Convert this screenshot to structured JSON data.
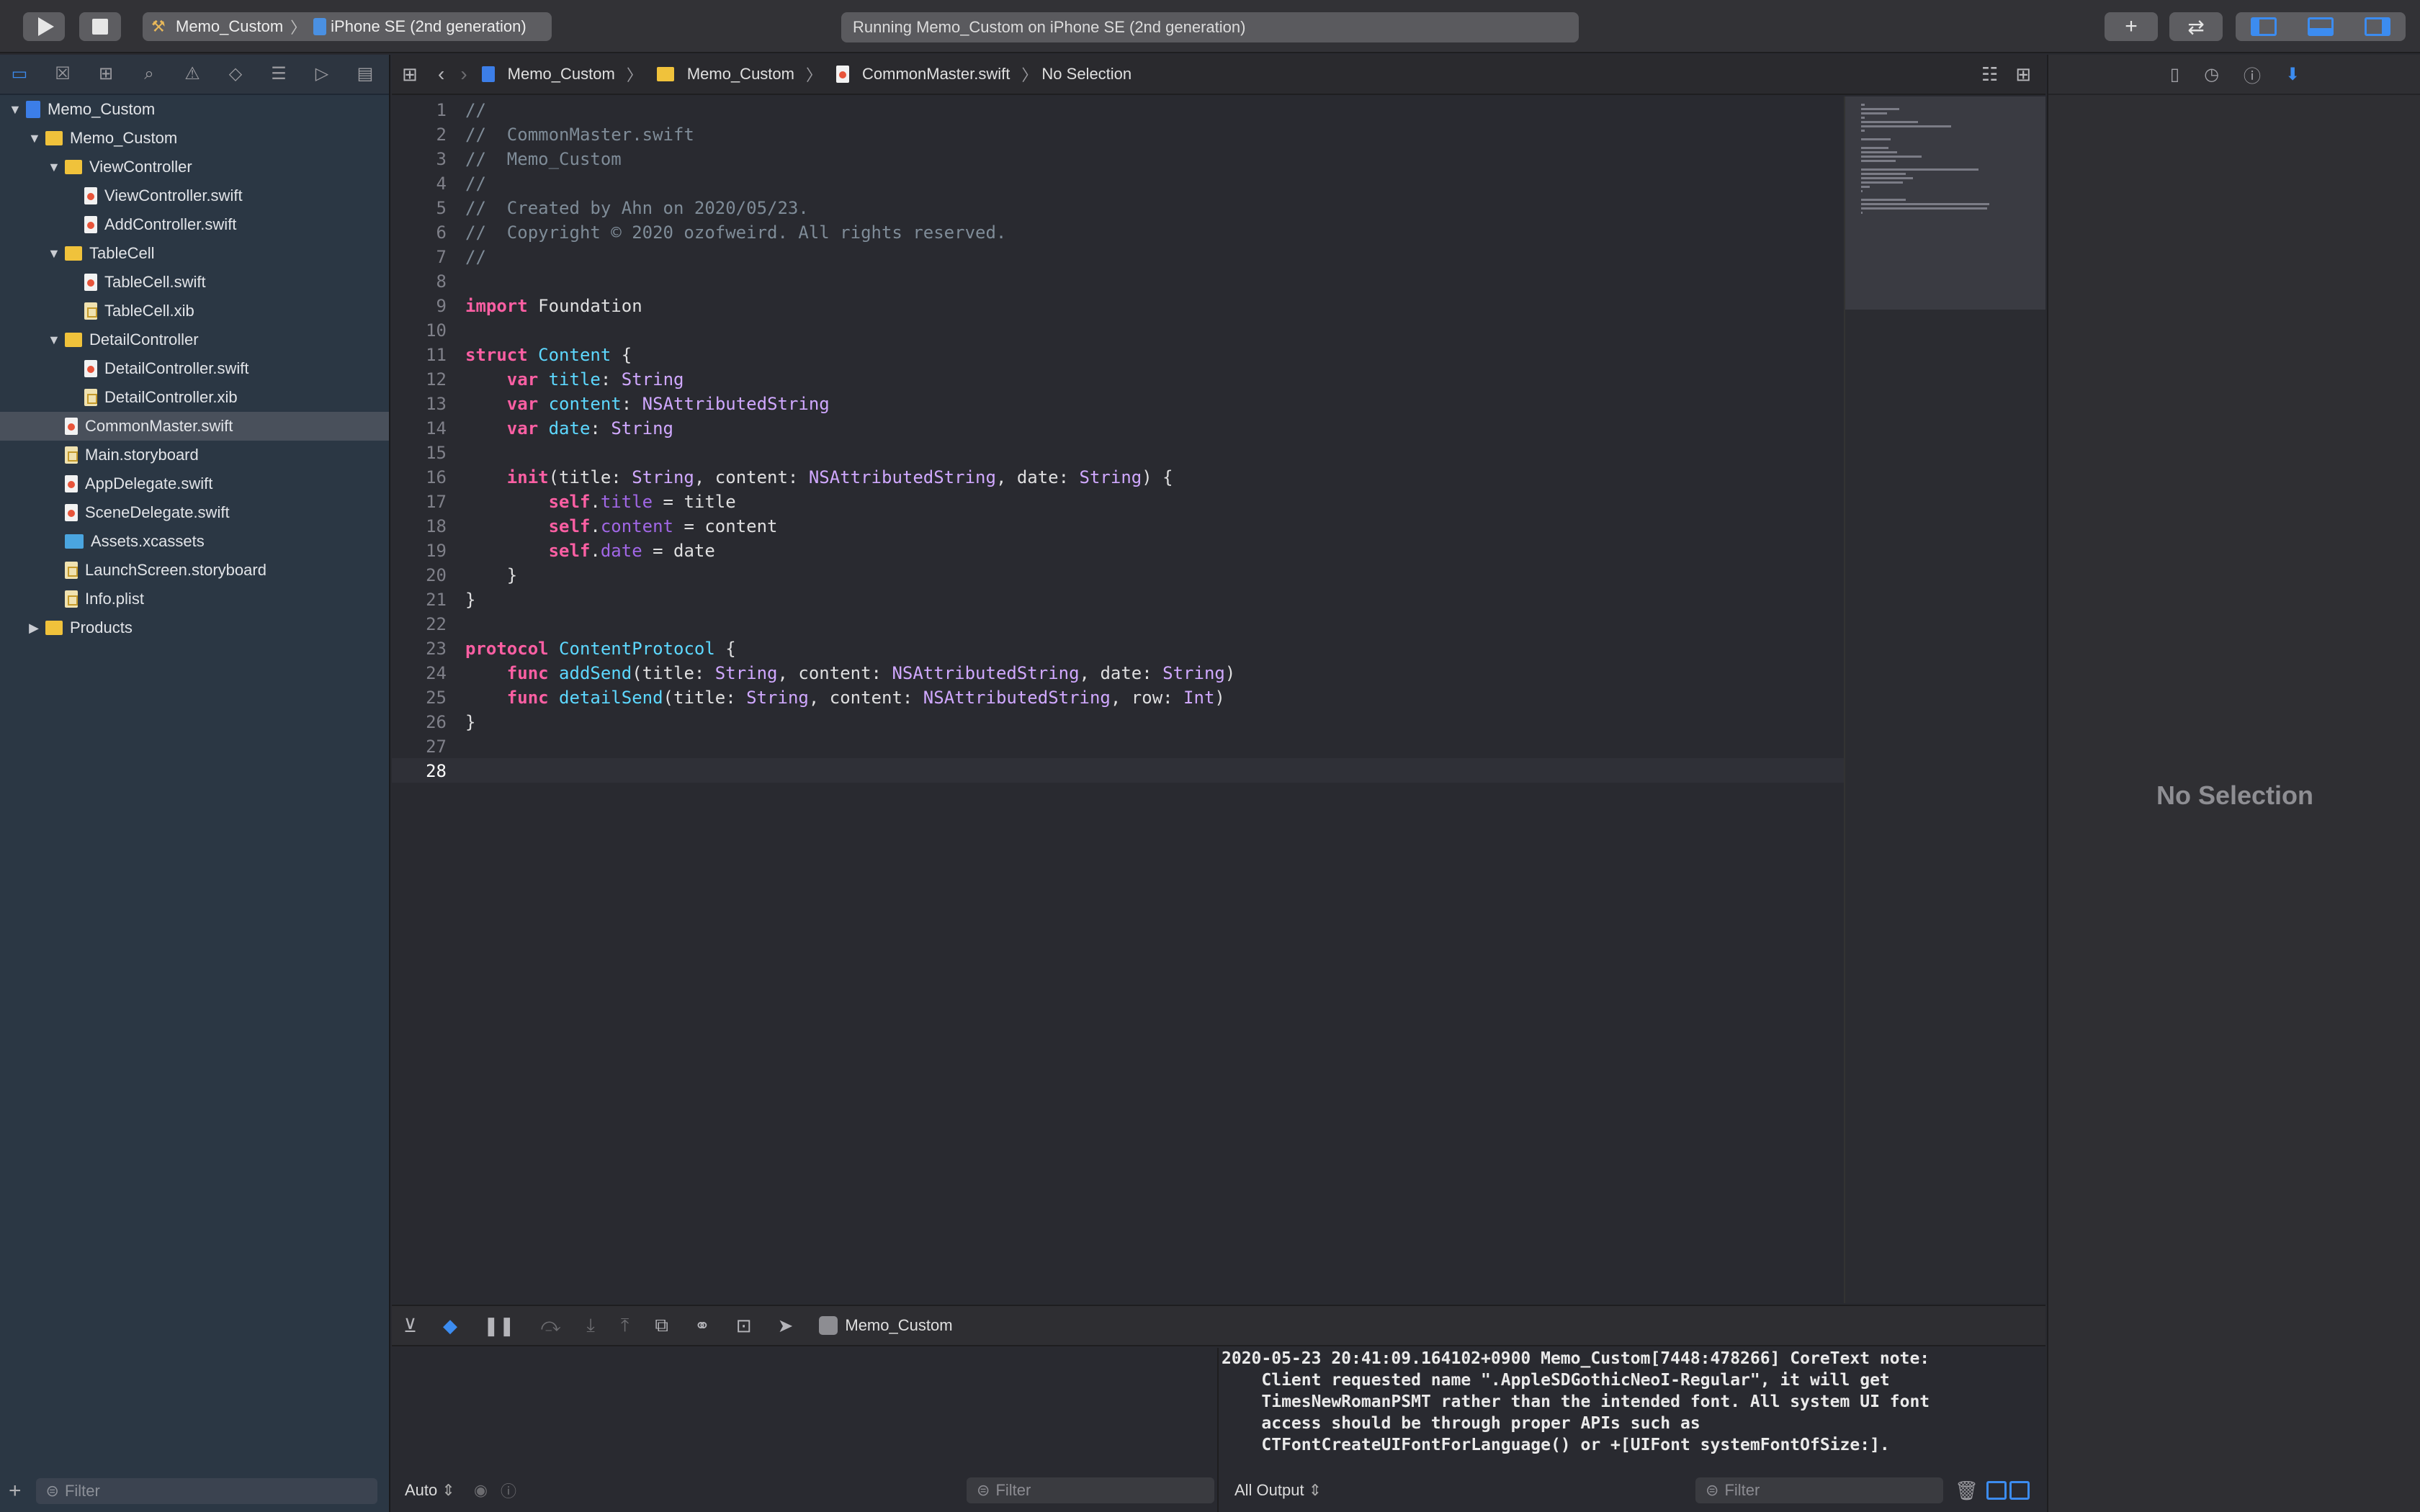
{
  "toolbar": {
    "scheme": "Memo_Custom",
    "destination": "iPhone SE (2nd generation)",
    "status": "Running Memo_Custom on iPhone SE (2nd generation)"
  },
  "navigator": {
    "tree": [
      {
        "label": "Memo_Custom",
        "kind": "proj",
        "indent": 0,
        "disc": "open"
      },
      {
        "label": "Memo_Custom",
        "kind": "folder",
        "indent": 1,
        "disc": "open"
      },
      {
        "label": "ViewController",
        "kind": "folder",
        "indent": 2,
        "disc": "open"
      },
      {
        "label": "ViewController.swift",
        "kind": "swift",
        "indent": 3
      },
      {
        "label": "AddController.swift",
        "kind": "swift",
        "indent": 3
      },
      {
        "label": "TableCell",
        "kind": "folder",
        "indent": 2,
        "disc": "open"
      },
      {
        "label": "TableCell.swift",
        "kind": "swift",
        "indent": 3
      },
      {
        "label": "TableCell.xib",
        "kind": "xib",
        "indent": 3
      },
      {
        "label": "DetailController",
        "kind": "folder",
        "indent": 2,
        "disc": "open"
      },
      {
        "label": "DetailController.swift",
        "kind": "swift",
        "indent": 3
      },
      {
        "label": "DetailController.xib",
        "kind": "xib",
        "indent": 3
      },
      {
        "label": "CommonMaster.swift",
        "kind": "swift",
        "indent": 2,
        "selected": true
      },
      {
        "label": "Main.storyboard",
        "kind": "xib",
        "indent": 2
      },
      {
        "label": "AppDelegate.swift",
        "kind": "swift",
        "indent": 2
      },
      {
        "label": "SceneDelegate.swift",
        "kind": "swift",
        "indent": 2
      },
      {
        "label": "Assets.xcassets",
        "kind": "assets",
        "indent": 2
      },
      {
        "label": "LaunchScreen.storyboard",
        "kind": "xib",
        "indent": 2
      },
      {
        "label": "Info.plist",
        "kind": "xib",
        "indent": 2
      },
      {
        "label": "Products",
        "kind": "folder",
        "indent": 1,
        "disc": "closed"
      }
    ],
    "filter_placeholder": "Filter"
  },
  "jumpbar": {
    "crumbs": [
      "Memo_Custom",
      "Memo_Custom",
      "CommonMaster.swift",
      "No Selection"
    ]
  },
  "editor": {
    "current_line": 28,
    "lines": [
      [
        [
          "c",
          "//"
        ]
      ],
      [
        [
          "c",
          "//  CommonMaster.swift"
        ]
      ],
      [
        [
          "c",
          "//  Memo_Custom"
        ]
      ],
      [
        [
          "c",
          "//"
        ]
      ],
      [
        [
          "c",
          "//  Created by Ahn on 2020/05/23."
        ]
      ],
      [
        [
          "c",
          "//  Copyright © 2020 ozofweird. All rights reserved."
        ]
      ],
      [
        [
          "c",
          "//"
        ]
      ],
      [],
      [
        [
          "k",
          "import"
        ],
        [
          "p",
          " Foundation"
        ]
      ],
      [],
      [
        [
          "k",
          "struct"
        ],
        [
          "p",
          " "
        ],
        [
          "d",
          "Content"
        ],
        [
          "p",
          " {"
        ]
      ],
      [
        [
          "p",
          "    "
        ],
        [
          "k",
          "var"
        ],
        [
          "p",
          " "
        ],
        [
          "d",
          "title"
        ],
        [
          "p",
          ": "
        ],
        [
          "t",
          "String"
        ]
      ],
      [
        [
          "p",
          "    "
        ],
        [
          "k",
          "var"
        ],
        [
          "p",
          " "
        ],
        [
          "d",
          "content"
        ],
        [
          "p",
          ": "
        ],
        [
          "t",
          "NSAttributedString"
        ]
      ],
      [
        [
          "p",
          "    "
        ],
        [
          "k",
          "var"
        ],
        [
          "p",
          " "
        ],
        [
          "d",
          "date"
        ],
        [
          "p",
          ": "
        ],
        [
          "t",
          "String"
        ]
      ],
      [],
      [
        [
          "p",
          "    "
        ],
        [
          "k",
          "init"
        ],
        [
          "p",
          "(title: "
        ],
        [
          "t",
          "String"
        ],
        [
          "p",
          ", content: "
        ],
        [
          "t",
          "NSAttributedString"
        ],
        [
          "p",
          ", date: "
        ],
        [
          "t",
          "String"
        ],
        [
          "p",
          ") {"
        ]
      ],
      [
        [
          "p",
          "        "
        ],
        [
          "k",
          "self"
        ],
        [
          "p",
          "."
        ],
        [
          "r",
          "title"
        ],
        [
          "p",
          " = title"
        ]
      ],
      [
        [
          "p",
          "        "
        ],
        [
          "k",
          "self"
        ],
        [
          "p",
          "."
        ],
        [
          "r",
          "content"
        ],
        [
          "p",
          " = content"
        ]
      ],
      [
        [
          "p",
          "        "
        ],
        [
          "k",
          "self"
        ],
        [
          "p",
          "."
        ],
        [
          "r",
          "date"
        ],
        [
          "p",
          " = date"
        ]
      ],
      [
        [
          "p",
          "    }"
        ]
      ],
      [
        [
          "p",
          "}"
        ]
      ],
      [],
      [
        [
          "k",
          "protocol"
        ],
        [
          "p",
          " "
        ],
        [
          "d",
          "ContentProtocol"
        ],
        [
          "p",
          " {"
        ]
      ],
      [
        [
          "p",
          "    "
        ],
        [
          "k",
          "func"
        ],
        [
          "p",
          " "
        ],
        [
          "d",
          "addSend"
        ],
        [
          "p",
          "(title: "
        ],
        [
          "t",
          "String"
        ],
        [
          "p",
          ", content: "
        ],
        [
          "t",
          "NSAttributedString"
        ],
        [
          "p",
          ", date: "
        ],
        [
          "t",
          "String"
        ],
        [
          "p",
          ")"
        ]
      ],
      [
        [
          "p",
          "    "
        ],
        [
          "k",
          "func"
        ],
        [
          "p",
          " "
        ],
        [
          "d",
          "detailSend"
        ],
        [
          "p",
          "(title: "
        ],
        [
          "t",
          "String"
        ],
        [
          "p",
          ", content: "
        ],
        [
          "t",
          "NSAttributedString"
        ],
        [
          "p",
          ", row: "
        ],
        [
          "t",
          "Int"
        ],
        [
          "p",
          ")"
        ]
      ],
      [
        [
          "p",
          "}"
        ]
      ],
      [],
      []
    ]
  },
  "debug": {
    "target": "Memo_Custom",
    "auto_label": "Auto",
    "var_filter_placeholder": "Filter",
    "output_label": "All Output",
    "console_filter_placeholder": "Filter",
    "console_text": "2020-05-23 20:41:09.164102+0900 Memo_Custom[7448:478266] CoreText note:\n    Client requested name \".AppleSDGothicNeoI-Regular\", it will get\n    TimesNewRomanPSMT rather than the intended font. All system UI font\n    access should be through proper APIs such as\n    CTFontCreateUIFontForLanguage() or +[UIFont systemFontOfSize:]."
  },
  "inspector": {
    "empty_label": "No Selection"
  }
}
